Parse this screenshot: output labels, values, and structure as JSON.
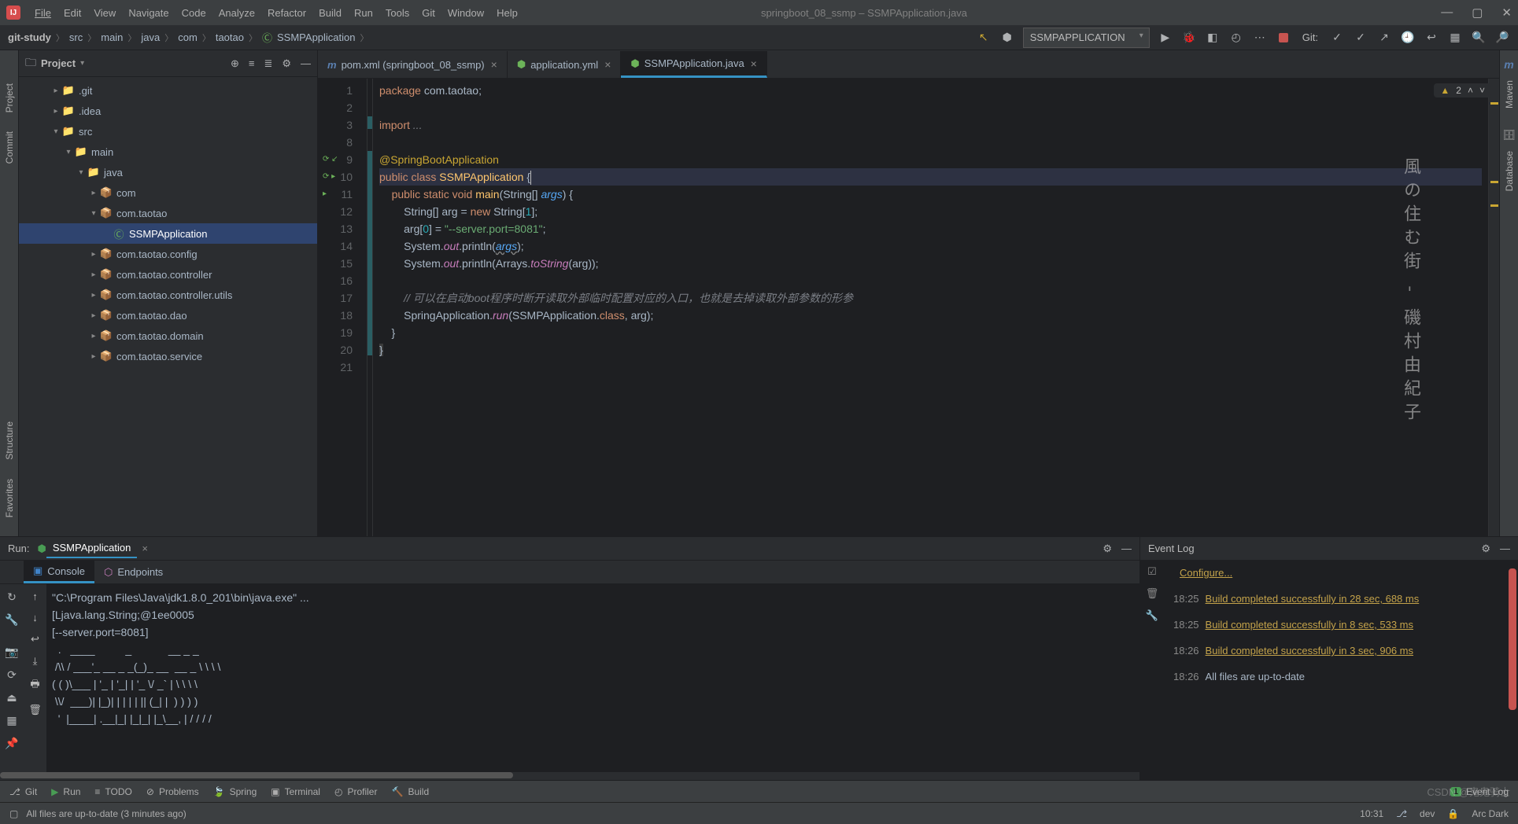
{
  "menu": [
    "File",
    "Edit",
    "View",
    "Navigate",
    "Code",
    "Analyze",
    "Refactor",
    "Build",
    "Run",
    "Tools",
    "Git",
    "Window",
    "Help"
  ],
  "window_title": "springboot_08_ssmp – SSMPApplication.java",
  "breadcrumb": [
    "git-study",
    "src",
    "main",
    "java",
    "com",
    "taotao",
    "SSMPApplication"
  ],
  "run_config_selected": "SSMPAPPLICATION",
  "git_label": "Git:",
  "project_panel": {
    "title": "Project"
  },
  "tree": [
    {
      "indent": 1,
      "tw": "▸",
      "icon": "📁",
      "cls": "folder-col",
      "label": ".git"
    },
    {
      "indent": 1,
      "tw": "▸",
      "icon": "📁",
      "cls": "folder-col",
      "label": ".idea"
    },
    {
      "indent": 1,
      "tw": "▾",
      "icon": "📁",
      "cls": "src-col",
      "label": "src"
    },
    {
      "indent": 2,
      "tw": "▾",
      "icon": "📁",
      "cls": "src-col",
      "label": "main"
    },
    {
      "indent": 3,
      "tw": "▾",
      "icon": "📁",
      "cls": "src-col",
      "label": "java"
    },
    {
      "indent": 4,
      "tw": "▸",
      "icon": "📦",
      "cls": "pkg-col",
      "label": "com"
    },
    {
      "indent": 4,
      "tw": "▾",
      "icon": "📦",
      "cls": "pkg-col",
      "label": "com.taotao"
    },
    {
      "indent": 5,
      "tw": "",
      "icon": "Ⓒ",
      "cls": "java-icon",
      "label": "SSMPApplication",
      "selected": true
    },
    {
      "indent": 4,
      "tw": "▸",
      "icon": "📦",
      "cls": "pkg-col",
      "label": "com.taotao.config"
    },
    {
      "indent": 4,
      "tw": "▸",
      "icon": "📦",
      "cls": "pkg-col",
      "label": "com.taotao.controller"
    },
    {
      "indent": 4,
      "tw": "▸",
      "icon": "📦",
      "cls": "pkg-col",
      "label": "com.taotao.controller.utils"
    },
    {
      "indent": 4,
      "tw": "▸",
      "icon": "📦",
      "cls": "pkg-col",
      "label": "com.taotao.dao"
    },
    {
      "indent": 4,
      "tw": "▸",
      "icon": "📦",
      "cls": "pkg-col",
      "label": "com.taotao.domain"
    },
    {
      "indent": 4,
      "tw": "▸",
      "icon": "📦",
      "cls": "pkg-col",
      "label": "com.taotao.service"
    }
  ],
  "editor_tabs": [
    {
      "icon": "m",
      "icon_cls": "m-icon",
      "label": "pom.xml (springboot_08_ssmp)",
      "active": false
    },
    {
      "icon": "⬢",
      "icon_cls": "yml-icon",
      "label": "application.yml",
      "active": false
    },
    {
      "icon": "⬢",
      "icon_cls": "java-icon",
      "label": "SSMPApplication.java",
      "active": true
    }
  ],
  "warnings_count": "2",
  "code_lines": [
    {
      "n": 1,
      "html": "<span class='k'>package</span> com.taotao;"
    },
    {
      "n": 2,
      "html": ""
    },
    {
      "n": 3,
      "html": "<span class='k'>import</span> <span class='c'>...</span>"
    },
    {
      "n": 8,
      "html": ""
    },
    {
      "n": 9,
      "html": "<span class='a'>@SpringBootApplication</span>",
      "gicons": "⟳ ↙"
    },
    {
      "n": 10,
      "html": "<span class='k'>public</span> <span class='k'>class</span> <span class='t'>SSMPApplication</span> {<span class='cursor-mark'></span>",
      "hl": true,
      "gicons": "⟳ ▸"
    },
    {
      "n": 11,
      "html": "    <span class='k'>public</span> <span class='k'>static</span> <span class='k'>void</span> <span class='m'>main</span>(String[] <span class='p it'>args</span>) {",
      "gicons": "  ▸"
    },
    {
      "n": 12,
      "html": "        String[] arg = <span class='k'>new</span> String[<span class='n'>1</span>];"
    },
    {
      "n": 13,
      "html": "        arg[<span class='n'>0</span>] = <span class='s'>\"--server.port=8081\"</span>;"
    },
    {
      "n": 14,
      "html": "        System.<span class='st'>out</span>.println(<span class='p it' style='text-decoration:underline wavy #808080'>args</span>);"
    },
    {
      "n": 15,
      "html": "        System.<span class='st'>out</span>.println(Arrays.<span class='st it'>toString</span>(arg));"
    },
    {
      "n": 16,
      "html": ""
    },
    {
      "n": 17,
      "html": "        <span class='c'>// 可以在启动boot程序时断开读取外部临时配置对应的入口，也就是去掉读取外部参数的形参</span>"
    },
    {
      "n": 18,
      "html": "        SpringApplication.<span class='st it'>run</span>(SSMPApplication.<span class='k'>class</span>, arg);"
    },
    {
      "n": 19,
      "html": "    }"
    },
    {
      "n": 20,
      "html": "<span style='background:#3b3b3b'>}</span>"
    },
    {
      "n": 21,
      "html": ""
    }
  ],
  "run_panel": {
    "title": "Run:",
    "config": "SSMPApplication",
    "sub_tabs": [
      "Console",
      "Endpoints"
    ],
    "console_lines": [
      "\"C:\\Program Files\\Java\\jdk1.8.0_201\\bin\\java.exe\" ...",
      "[Ljava.lang.String;@1ee0005",
      "[--server.port=8081]",
      "",
      "  .   ____          _            __ _ _",
      " /\\\\ / ___'_ __ _ _(_)_ __  __ _ \\ \\ \\ \\",
      "( ( )\\___ | '_ | '_| | '_ \\/ _` | \\ \\ \\ \\",
      " \\\\/  ___)| |_)| | | | | || (_| |  ) ) ) )",
      "  '  |____| .__|_| |_|_| |_\\__, | / / / /"
    ]
  },
  "event_log": {
    "title": "Event Log",
    "configure": "Configure...",
    "entries": [
      {
        "time": "18:25",
        "text": "Build completed successfully in 28 sec, 688 ms",
        "link": true
      },
      {
        "time": "18:25",
        "text": "Build completed successfully in 8 sec, 533 ms",
        "link": true
      },
      {
        "time": "18:26",
        "text": "Build completed successfully in 3 sec, 906 ms",
        "link": true
      },
      {
        "time": "18:26",
        "text": "All files are up-to-date",
        "link": false
      }
    ]
  },
  "bottom_tools": [
    "Git",
    "Run",
    "TODO",
    "Problems",
    "Spring",
    "Terminal",
    "Profiler",
    "Build"
  ],
  "event_log_btn": "Event Log",
  "event_badge": "1",
  "status": {
    "left": "All files are up-to-date (3 minutes ago)",
    "clock": "10:31",
    "branch": "dev",
    "theme": "Arc Dark"
  },
  "left_rails": [
    "Project",
    "Commit"
  ],
  "left_rails2": [
    "Structure",
    "Favorites"
  ],
  "right_rails": [
    "Maven",
    "Database"
  ],
  "watermark": "風の住む街 - 磯村由紀子",
  "csdn": "CSDN @鬼鬼骑士"
}
